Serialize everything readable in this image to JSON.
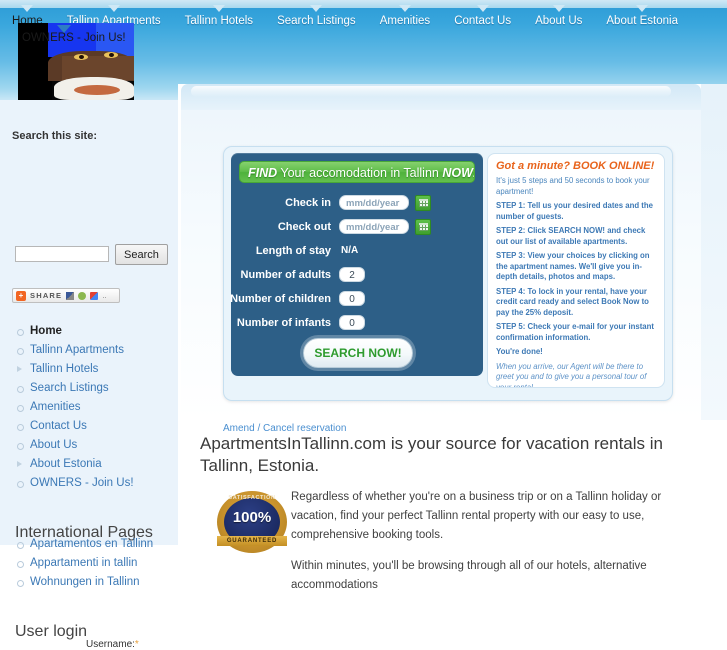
{
  "site": {
    "name": "ApartmentsInTallinn.com"
  },
  "top_nav": {
    "items": [
      {
        "label": "Home",
        "active": true
      },
      {
        "label": "Tallinn Apartments",
        "active": false
      },
      {
        "label": "Tallinn Hotels",
        "active": false
      },
      {
        "label": "Search Listings",
        "active": false
      },
      {
        "label": "Amenities",
        "active": false
      },
      {
        "label": "Contact Us",
        "active": false
      },
      {
        "label": "About Us",
        "active": false
      },
      {
        "label": "About Estonia",
        "active": false
      }
    ],
    "owners_label": "OWNERS - Join Us!"
  },
  "sidebar": {
    "search": {
      "label": "Search this site:",
      "value": "",
      "placeholder": "",
      "button_label": "Search"
    },
    "share": {
      "label": "SHARE",
      "plus": "+",
      "dots": ".."
    },
    "menu": [
      {
        "label": "Home",
        "bullet": "circle",
        "active": true
      },
      {
        "label": "Tallinn Apartments",
        "bullet": "circle",
        "active": false
      },
      {
        "label": "Tallinn Hotels",
        "bullet": "triangle",
        "active": false
      },
      {
        "label": "Search Listings",
        "bullet": "circle",
        "active": false
      },
      {
        "label": "Amenities",
        "bullet": "circle",
        "active": false
      },
      {
        "label": "Contact Us",
        "bullet": "circle",
        "active": false
      },
      {
        "label": "About Us",
        "bullet": "circle",
        "active": false
      },
      {
        "label": "About Estonia",
        "bullet": "triangle",
        "active": false
      },
      {
        "label": "OWNERS - Join Us!",
        "bullet": "circle",
        "active": false
      }
    ],
    "international": {
      "heading": "International Pages",
      "items": [
        {
          "label": "Apartamentos en Tallinn",
          "bullet": "circle"
        },
        {
          "label": "Appartamenti in tallin",
          "bullet": "circle"
        },
        {
          "label": "Wohnungen in Tallinn",
          "bullet": "circle"
        }
      ]
    },
    "login": {
      "heading": "User login",
      "username_label": "Username:",
      "required_mark": "*"
    }
  },
  "booking": {
    "banner": {
      "find": "FIND",
      "middle": " Your accomodation in Tallinn ",
      "now": "NOW!"
    },
    "fields": [
      {
        "label": "Check in",
        "type": "date",
        "value": "mm/dd/year",
        "calendar": true
      },
      {
        "label": "Check out",
        "type": "date",
        "value": "mm/dd/year",
        "calendar": true
      },
      {
        "label": "Length of stay",
        "type": "static",
        "value": "N/A",
        "calendar": false
      },
      {
        "label": "Number of adults",
        "type": "number",
        "value": "2",
        "calendar": false
      },
      {
        "label": "Number of children",
        "type": "number",
        "value": "0",
        "calendar": false
      },
      {
        "label": "Number of infants",
        "type": "number",
        "value": "0",
        "calendar": false
      }
    ],
    "submit_label": "SEARCH NOW!",
    "amend_link": "Amend / Cancel reservation",
    "panel": {
      "heading_q": "Got a minute? ",
      "heading_loud": "BOOK ONLINE!",
      "intro": "It's just 5 steps and 50 seconds to book your apartment!",
      "steps": [
        "STEP 1: Tell us your desired dates and the number of guests.",
        "STEP 2: Click SEARCH NOW! and check out our list of available apartments.",
        "STEP 3: View your choices by clicking on the apartment names. We'll give you in-depth details, photos and maps.",
        "STEP 4: To lock in your rental, have your credit card ready and select Book Now to pay the 25% deposit.",
        "STEP 5: Check your e-mail for your instant confirmation information."
      ],
      "done": "You're done!",
      "closing": "When you arrive, our Agent will be there to greet you and to give you a personal tour of your rental."
    }
  },
  "article": {
    "heading": "ApartmentsInTallinn.com is your source for vacation rentals in Tallinn, Estonia.",
    "paragraphs": [
      "Regardless of whether you're on a business trip or on a Tallinn holiday or vacation, find your perfect Tallinn rental property with our easy to use, comprehensive booking tools.",
      "Within minutes, you'll be browsing through all of our hotels, alternative accommodations"
    ],
    "badge": {
      "top": "SATISFACTION",
      "value": "100%",
      "bottom": "GUARANTEED"
    }
  },
  "colors": {
    "header_blue": "#2a9ad6",
    "sidebar_bg": "#eaf3fb",
    "link_blue": "#3b78b5",
    "booking_navy": "#2d5f87",
    "accent_green": "#4fb23c",
    "accent_orange": "#e8641c"
  }
}
